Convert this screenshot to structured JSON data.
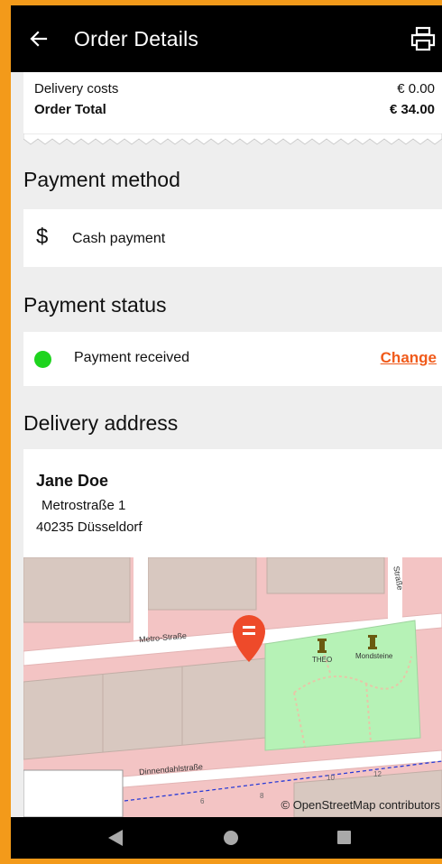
{
  "app_bar": {
    "title": "Order Details",
    "back_icon": "arrow-left-icon",
    "print_icon": "printer-icon"
  },
  "totals": {
    "delivery_costs_label": "Delivery costs",
    "delivery_costs_value": "€ 0.00",
    "order_total_label": "Order Total",
    "order_total_value": "€ 34.00"
  },
  "payment_method": {
    "heading": "Payment method",
    "symbol": "$",
    "label": "Cash payment"
  },
  "payment_status": {
    "heading": "Payment status",
    "status_color": "#1ed41e",
    "label": "Payment received",
    "change_label": "Change"
  },
  "delivery_address": {
    "heading": "Delivery address",
    "name": "Jane Doe",
    "street": "Metrostraße 1",
    "city": "40235 Düsseldorf"
  },
  "map": {
    "street_labels": [
      "Metro-Straße",
      "Dinnendahlstraße",
      "Straße"
    ],
    "poi_labels": [
      "THEO",
      "Mondsteine"
    ],
    "house_numbers": [
      "10",
      "12",
      "6",
      "8"
    ],
    "attribution": "© OpenStreetMap contributors",
    "pin_color": "#ee4a2a"
  },
  "colors": {
    "accent": "#f05a1a",
    "frame": "#f39a1a"
  }
}
